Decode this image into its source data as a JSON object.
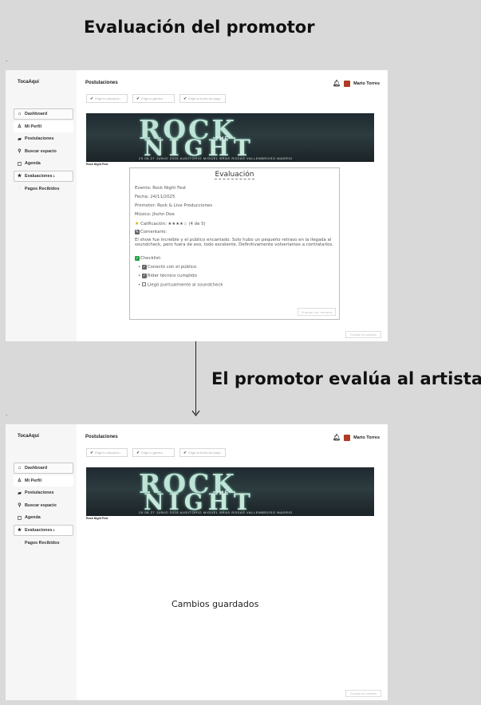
{
  "headings": {
    "top": "Evaluación del promotor",
    "middle": "El promotor evalúa al artista"
  },
  "app": {
    "brand": "TocaAquí",
    "page_title": "Postulaciones",
    "user_name": "Mario Torres",
    "sidebar": [
      {
        "label": "Dashboard",
        "icon": "home-icon"
      },
      {
        "label": "Mi Perfil",
        "icon": "user-icon"
      },
      {
        "label": "Postulaciones",
        "icon": "documents-icon"
      },
      {
        "label": "Buscar espacio",
        "icon": "search-icon"
      },
      {
        "label": "Agenda",
        "icon": "calendar-icon"
      },
      {
        "label": "Evaluaciones",
        "icon": "star-icon",
        "badge": "1"
      },
      {
        "label": "Pagos Recibidos",
        "icon": "payments-icon"
      }
    ],
    "filters": [
      "Elige tu ubicación",
      "Elige tu género",
      "Elige la fecha del pago"
    ],
    "banner": {
      "title_1": "ROCK",
      "title_the": "THE",
      "title_2": "NIGHT",
      "info": "25.06.27   JUNIO   2025   AUDITORIO MIGUEL BRAS   ROXAS VALLEMBROSO   MADRID",
      "caption": "Rock Night Fest"
    },
    "corner_button": "Guardar los cambios"
  },
  "modal": {
    "title": "Evaluación",
    "evento": "Evento: Rock Night Fest",
    "fecha": "Fecha: 24/11/2025",
    "promotor": "Promotor: Rock & Live Producciones",
    "musico": "Músico: Jhohn Doe",
    "calificacion": "Calificación: ★★★★☆ (4 de 5)",
    "comentario_label": "Comentario:",
    "comentario": "El show fue increíble y el público encantado. Solo hubo un pequeño retraso en la llegada al soundcheck, pero fuera de eso, todo excelente. Definitivamente volveríamos a contratarlos.",
    "checklist_label": "Checklist:",
    "checklist": [
      {
        "label": "Conectó con el público",
        "checked": true
      },
      {
        "label": "Rider técnico cumplido",
        "checked": true
      },
      {
        "label": "Llegó puntualmente al soundcheck",
        "checked": false
      }
    ],
    "button": "Guardar las cambios"
  },
  "saved_message": "Cambios guardados",
  "colors": {
    "background": "#d9d9d9",
    "sidebar": "#f6f6f7",
    "check_green": "#22a046",
    "avatar": "#b03a25"
  }
}
